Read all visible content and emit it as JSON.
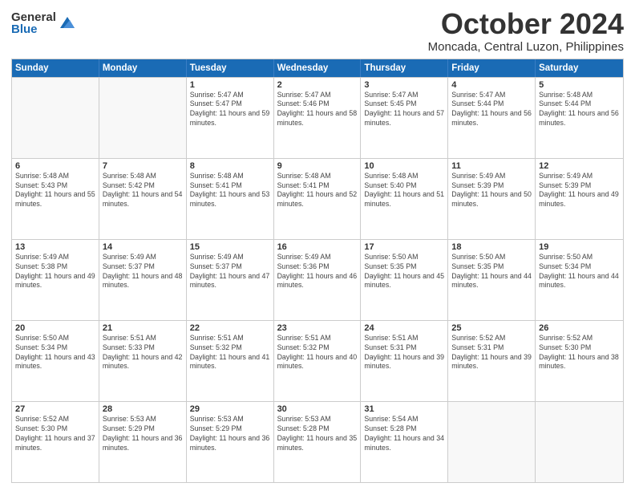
{
  "logo": {
    "general": "General",
    "blue": "Blue"
  },
  "title": "October 2024",
  "subtitle": "Moncada, Central Luzon, Philippines",
  "days": [
    "Sunday",
    "Monday",
    "Tuesday",
    "Wednesday",
    "Thursday",
    "Friday",
    "Saturday"
  ],
  "weeks": [
    [
      {
        "day": "",
        "empty": true
      },
      {
        "day": "",
        "empty": true
      },
      {
        "day": "1",
        "sunrise": "5:47 AM",
        "sunset": "5:47 PM",
        "daylight": "Daylight: 11 hours and 59 minutes."
      },
      {
        "day": "2",
        "sunrise": "5:47 AM",
        "sunset": "5:46 PM",
        "daylight": "Daylight: 11 hours and 58 minutes."
      },
      {
        "day": "3",
        "sunrise": "5:47 AM",
        "sunset": "5:45 PM",
        "daylight": "Daylight: 11 hours and 57 minutes."
      },
      {
        "day": "4",
        "sunrise": "5:47 AM",
        "sunset": "5:44 PM",
        "daylight": "Daylight: 11 hours and 56 minutes."
      },
      {
        "day": "5",
        "sunrise": "5:48 AM",
        "sunset": "5:44 PM",
        "daylight": "Daylight: 11 hours and 56 minutes."
      }
    ],
    [
      {
        "day": "6",
        "sunrise": "5:48 AM",
        "sunset": "5:43 PM",
        "daylight": "Daylight: 11 hours and 55 minutes."
      },
      {
        "day": "7",
        "sunrise": "5:48 AM",
        "sunset": "5:42 PM",
        "daylight": "Daylight: 11 hours and 54 minutes."
      },
      {
        "day": "8",
        "sunrise": "5:48 AM",
        "sunset": "5:41 PM",
        "daylight": "Daylight: 11 hours and 53 minutes."
      },
      {
        "day": "9",
        "sunrise": "5:48 AM",
        "sunset": "5:41 PM",
        "daylight": "Daylight: 11 hours and 52 minutes."
      },
      {
        "day": "10",
        "sunrise": "5:48 AM",
        "sunset": "5:40 PM",
        "daylight": "Daylight: 11 hours and 51 minutes."
      },
      {
        "day": "11",
        "sunrise": "5:49 AM",
        "sunset": "5:39 PM",
        "daylight": "Daylight: 11 hours and 50 minutes."
      },
      {
        "day": "12",
        "sunrise": "5:49 AM",
        "sunset": "5:39 PM",
        "daylight": "Daylight: 11 hours and 49 minutes."
      }
    ],
    [
      {
        "day": "13",
        "sunrise": "5:49 AM",
        "sunset": "5:38 PM",
        "daylight": "Daylight: 11 hours and 49 minutes."
      },
      {
        "day": "14",
        "sunrise": "5:49 AM",
        "sunset": "5:37 PM",
        "daylight": "Daylight: 11 hours and 48 minutes."
      },
      {
        "day": "15",
        "sunrise": "5:49 AM",
        "sunset": "5:37 PM",
        "daylight": "Daylight: 11 hours and 47 minutes."
      },
      {
        "day": "16",
        "sunrise": "5:49 AM",
        "sunset": "5:36 PM",
        "daylight": "Daylight: 11 hours and 46 minutes."
      },
      {
        "day": "17",
        "sunrise": "5:50 AM",
        "sunset": "5:35 PM",
        "daylight": "Daylight: 11 hours and 45 minutes."
      },
      {
        "day": "18",
        "sunrise": "5:50 AM",
        "sunset": "5:35 PM",
        "daylight": "Daylight: 11 hours and 44 minutes."
      },
      {
        "day": "19",
        "sunrise": "5:50 AM",
        "sunset": "5:34 PM",
        "daylight": "Daylight: 11 hours and 44 minutes."
      }
    ],
    [
      {
        "day": "20",
        "sunrise": "5:50 AM",
        "sunset": "5:34 PM",
        "daylight": "Daylight: 11 hours and 43 minutes."
      },
      {
        "day": "21",
        "sunrise": "5:51 AM",
        "sunset": "5:33 PM",
        "daylight": "Daylight: 11 hours and 42 minutes."
      },
      {
        "day": "22",
        "sunrise": "5:51 AM",
        "sunset": "5:32 PM",
        "daylight": "Daylight: 11 hours and 41 minutes."
      },
      {
        "day": "23",
        "sunrise": "5:51 AM",
        "sunset": "5:32 PM",
        "daylight": "Daylight: 11 hours and 40 minutes."
      },
      {
        "day": "24",
        "sunrise": "5:51 AM",
        "sunset": "5:31 PM",
        "daylight": "Daylight: 11 hours and 39 minutes."
      },
      {
        "day": "25",
        "sunrise": "5:52 AM",
        "sunset": "5:31 PM",
        "daylight": "Daylight: 11 hours and 39 minutes."
      },
      {
        "day": "26",
        "sunrise": "5:52 AM",
        "sunset": "5:30 PM",
        "daylight": "Daylight: 11 hours and 38 minutes."
      }
    ],
    [
      {
        "day": "27",
        "sunrise": "5:52 AM",
        "sunset": "5:30 PM",
        "daylight": "Daylight: 11 hours and 37 minutes."
      },
      {
        "day": "28",
        "sunrise": "5:53 AM",
        "sunset": "5:29 PM",
        "daylight": "Daylight: 11 hours and 36 minutes."
      },
      {
        "day": "29",
        "sunrise": "5:53 AM",
        "sunset": "5:29 PM",
        "daylight": "Daylight: 11 hours and 36 minutes."
      },
      {
        "day": "30",
        "sunrise": "5:53 AM",
        "sunset": "5:28 PM",
        "daylight": "Daylight: 11 hours and 35 minutes."
      },
      {
        "day": "31",
        "sunrise": "5:54 AM",
        "sunset": "5:28 PM",
        "daylight": "Daylight: 11 hours and 34 minutes."
      },
      {
        "day": "",
        "empty": true
      },
      {
        "day": "",
        "empty": true
      }
    ]
  ]
}
